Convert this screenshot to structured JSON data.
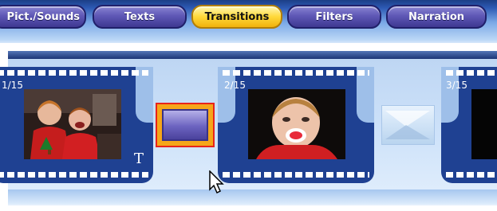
{
  "tabs": [
    {
      "label": "Pict./Sounds",
      "active": false
    },
    {
      "label": "Texts",
      "active": false
    },
    {
      "label": "Transitions",
      "active": true
    },
    {
      "label": "Filters",
      "active": false
    },
    {
      "label": "Narration",
      "active": false
    }
  ],
  "storyboard": {
    "frames": [
      {
        "number": "1/15",
        "text_marker": "T",
        "photo": "two-children-christmas-photo"
      },
      {
        "number": "2/15",
        "text_marker": "",
        "photo": "toddler-with-pacifier-photo"
      },
      {
        "number": "3/15",
        "text_marker": "",
        "photo": "dark-photo"
      }
    ],
    "transitions": [
      {
        "icon": "purple-fade-transition-icon",
        "selected": true
      },
      {
        "icon": "slide-transition-icon",
        "selected": false
      }
    ]
  },
  "colors": {
    "active_tab": "#ffd83a",
    "tab": "#5f58b6",
    "film": "#1f4192",
    "selection_border": "#e8241a"
  }
}
